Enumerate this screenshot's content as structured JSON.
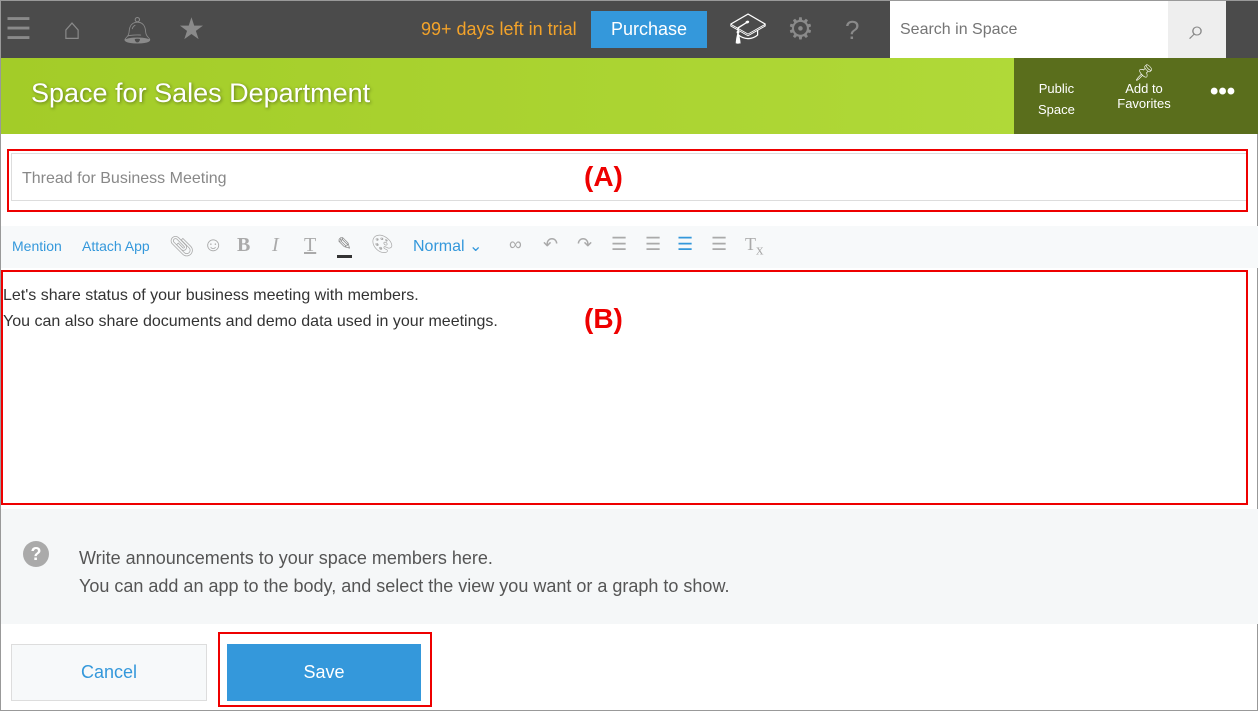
{
  "topbar": {
    "trial": "99+ days left in trial",
    "purchase": "Purchase",
    "search_placeholder": "Search in Space"
  },
  "banner": {
    "title": "Space for Sales Department",
    "public": [
      "Public",
      "Space"
    ],
    "favorites": [
      "Add to",
      "Favorites"
    ]
  },
  "subject": {
    "value": "Thread for Business Meeting"
  },
  "annotations": {
    "a": "(A)",
    "b": "(B)",
    "highlight_color": "#e00000"
  },
  "toolbar": {
    "mention": "Mention",
    "attach": "Attach App",
    "format": "Normal"
  },
  "body": {
    "lines": [
      "Let's share status of your business meeting with members.",
      "You can also share documents and demo data used in your meetings."
    ]
  },
  "help": {
    "lines": [
      "Write announcements to your space members here.",
      "You can add an app to the body, and select the view you want or a graph to show."
    ]
  },
  "actions": {
    "cancel": "Cancel",
    "save": "Save"
  }
}
